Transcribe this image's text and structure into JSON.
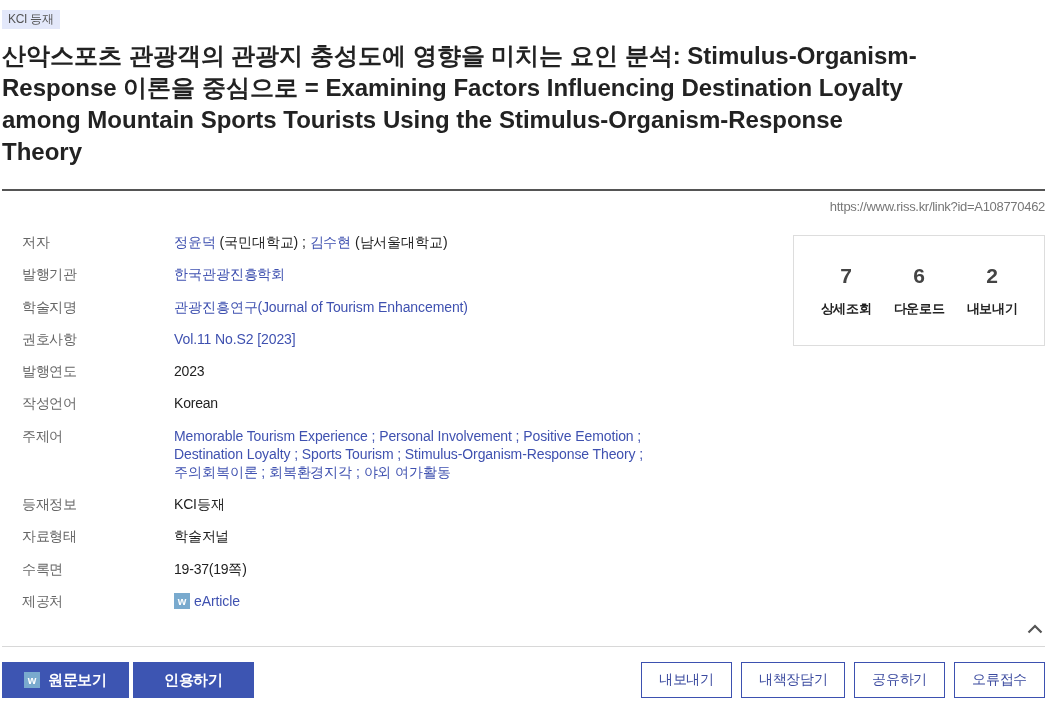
{
  "badge": "KCI 등재",
  "title": "산악스포츠 관광객의 관광지 충성도에 영향을 미치는 요인 분석: Stimulus-Organism-Response 이론을 중심으로 = Examining Factors Influencing Destination Loyalty among Mountain Sports Tourists Using the Stimulus-Organism-Response Theory",
  "permalink": "https://www.riss.kr/link?id=A108770462",
  "details": [
    {
      "label": "저자",
      "kind": "authors",
      "separator": ";",
      "authors": [
        {
          "name": "정윤덕",
          "affiliation": "(국민대학교)"
        },
        {
          "name": "김수현",
          "affiliation": "(남서울대학교)"
        }
      ]
    },
    {
      "label": "발행기관",
      "kind": "link",
      "value": "한국관광진흥학회"
    },
    {
      "label": "학술지명",
      "kind": "link",
      "value": "관광진흥연구(Journal of Tourism Enhancement)"
    },
    {
      "label": "권호사항",
      "kind": "link",
      "value": "Vol.11 No.S2 [2023]"
    },
    {
      "label": "발행연도",
      "kind": "text",
      "value": "2023"
    },
    {
      "label": "작성언어",
      "kind": "text",
      "value": "Korean"
    },
    {
      "label": "주제어",
      "kind": "keywords",
      "separator": ";",
      "keywords": [
        "Memorable Tourism Experience",
        "Personal Involvement",
        "Positive Eemotion",
        "Destination Loyalty",
        "Sports Tourism",
        "Stimulus-Organism-Response Theory",
        "주의회복이론",
        "회복환경지각",
        "야외 여가활동"
      ]
    },
    {
      "label": "등재정보",
      "kind": "text",
      "value": "KCI등재"
    },
    {
      "label": "자료형태",
      "kind": "text",
      "value": "학술저널"
    },
    {
      "label": "수록면",
      "kind": "text",
      "value": "19-37(19쪽)"
    },
    {
      "label": "제공처",
      "kind": "provider",
      "logo": "w",
      "value": "eArticle"
    }
  ],
  "stats": [
    {
      "count": "7",
      "label": "상세조회"
    },
    {
      "count": "6",
      "label": "다운로드"
    },
    {
      "count": "2",
      "label": "내보내기"
    }
  ],
  "actions": [
    {
      "label": "원문보기",
      "kind": "primary",
      "logo": "w"
    },
    {
      "label": "인용하기",
      "kind": "primary"
    },
    {
      "label": "내보내기",
      "kind": "outline"
    },
    {
      "label": "내책장담기",
      "kind": "outline"
    },
    {
      "label": "공유하기",
      "kind": "outline"
    },
    {
      "label": "오류접수",
      "kind": "outline"
    }
  ]
}
